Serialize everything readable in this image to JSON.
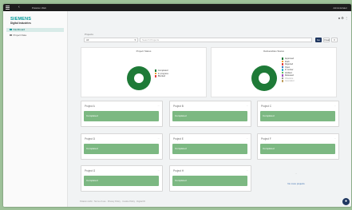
{
  "topbar": {
    "app_title": "Polarion Web",
    "user": "Administrator",
    "back": "‹"
  },
  "sidebar": {
    "brand": "SIEMENS",
    "product": "Digital Industries",
    "items": [
      {
        "label": "Dashboard"
      },
      {
        "label": "Project Data"
      }
    ]
  },
  "filters": {
    "scope_label": "Projects",
    "scope_value": "All",
    "search_placeholder": "Search Projects",
    "apply_label": "Go",
    "reset_label": "Clear"
  },
  "panels": {
    "left": {
      "title": "Project Status",
      "legend": [
        {
          "label": "Completed",
          "color": "#1e7a37"
        },
        {
          "label": "In progress",
          "color": "#f0a030"
        },
        {
          "label": "Blocked",
          "color": "#e04040"
        }
      ]
    },
    "right": {
      "title": "Deliverables Status",
      "legend": [
        {
          "label": "Approved",
          "color": "#1e7a37"
        },
        {
          "label": "Draft",
          "color": "#f0a030"
        },
        {
          "label": "Rejected",
          "color": "#e04040"
        },
        {
          "label": "Open",
          "color": "#3070c0"
        },
        {
          "label": "In review",
          "color": "#30b0d0"
        },
        {
          "label": "Verified",
          "color": "#60c060"
        },
        {
          "label": "Released",
          "color": "#a050c0"
        },
        {
          "label": "Obsolete",
          "color": "#999999"
        },
        {
          "label": "Cancelled",
          "color": "#c0a060"
        }
      ]
    }
  },
  "projects": [
    {
      "title": "Project A",
      "status": "Completed"
    },
    {
      "title": "Project B",
      "status": "Completed"
    },
    {
      "title": "Project C",
      "status": "Completed"
    },
    {
      "title": "Project D",
      "status": "Completed"
    },
    {
      "title": "Project E",
      "status": "Completed"
    },
    {
      "title": "Project F",
      "status": "Completed"
    },
    {
      "title": "Project G",
      "status": "Completed"
    },
    {
      "title": "Project H",
      "status": "Completed"
    }
  ],
  "empty_slot": {
    "line1": "...",
    "line2": "No more projects"
  },
  "footer": "Polarion ALM  ·  Terms of use  ·  Privacy Policy  ·  Cookie Policy  ·  Digital ID"
}
